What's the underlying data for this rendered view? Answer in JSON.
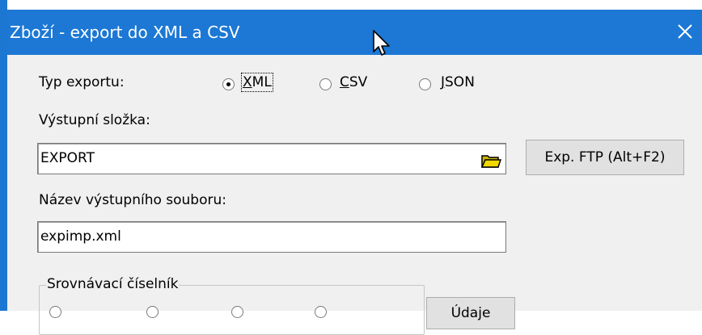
{
  "window": {
    "title": "Zboží - export do XML a CSV",
    "close_icon": "close-icon",
    "accent_color": "#1c78d4"
  },
  "export_type": {
    "label": "Typ exportu:",
    "options": [
      {
        "label_underlined": "X",
        "label_rest": "ML",
        "checked": true
      },
      {
        "label_underlined": "C",
        "label_rest": "SV",
        "checked": false
      },
      {
        "label_underlined": "J",
        "label_rest": "SON",
        "checked": false
      }
    ]
  },
  "output_folder": {
    "label": "Výstupní složka:",
    "value": "EXPORT",
    "browse_icon": "folder-icon"
  },
  "ftp_button": {
    "label": "Exp. FTP (Alt+F2)"
  },
  "output_file": {
    "label": "Název výstupního souboru:",
    "value": "expimp.xml"
  },
  "comparison_group": {
    "title": "Srovnávací číselník"
  },
  "udaje_button": {
    "label": "Údaje"
  }
}
